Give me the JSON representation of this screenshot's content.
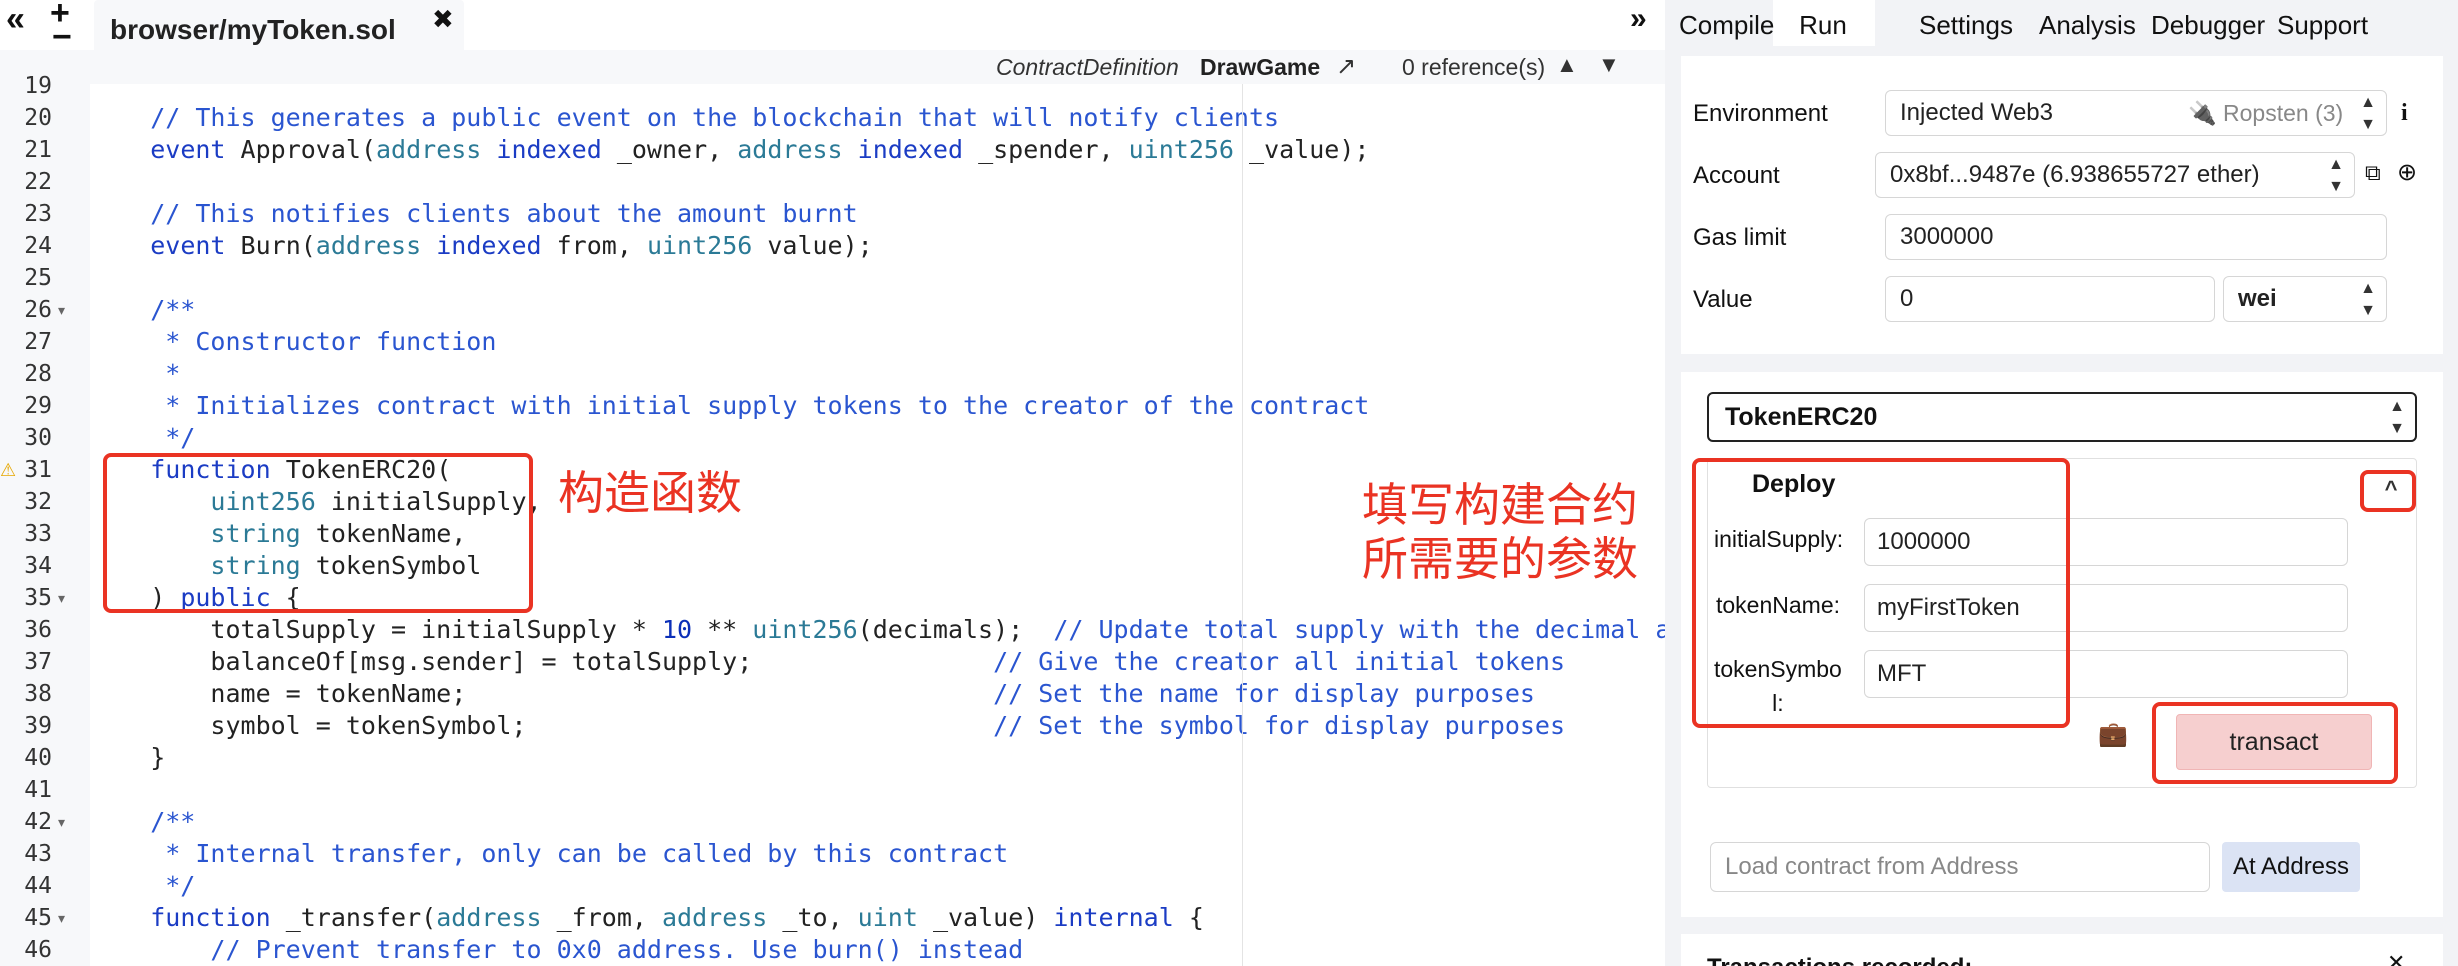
{
  "editor": {
    "tabbar": {
      "collapse_left": "«",
      "add_file": "+",
      "remove_file": "−",
      "active_tab": "browser/myToken.sol",
      "close": "✖",
      "collapse_right": "»"
    },
    "context": {
      "type": "ContractDefinition",
      "name": "DrawGame",
      "jump": "↗",
      "references": "0 reference(s)",
      "up": "▲",
      "down": "▼"
    },
    "line_numbers": [
      "19",
      "20",
      "21",
      "22",
      "23",
      "24",
      "25",
      "26",
      "27",
      "28",
      "29",
      "30",
      "31",
      "32",
      "33",
      "34",
      "35",
      "36",
      "37",
      "38",
      "39",
      "40",
      "41",
      "42",
      "43",
      "44",
      "45",
      "46"
    ],
    "code": [
      "",
      "    // This generates a public event on the blockchain that will notify clients",
      "    event Approval(address indexed _owner, address indexed _spender, uint256 _value);",
      "",
      "    // This notifies clients about the amount burnt",
      "    event Burn(address indexed from, uint256 value);",
      "",
      "    /**",
      "     * Constructor function",
      "     *",
      "     * Initializes contract with initial supply tokens to the creator of the contract",
      "     */",
      "    function TokenERC20(",
      "        uint256 initialSupply,",
      "        string tokenName,",
      "        string tokenSymbol",
      "    ) public {",
      "        totalSupply = initialSupply * 10 ** uint256(decimals);  // Update total supply with the decimal amount",
      "        balanceOf[msg.sender] = totalSupply;                // Give the creator all initial tokens",
      "        name = tokenName;                                   // Set the name for display purposes",
      "        symbol = tokenSymbol;                               // Set the symbol for display purposes",
      "    }",
      "",
      "    /**",
      "     * Internal transfer, only can be called by this contract",
      "     */",
      "    function _transfer(address _from, address _to, uint _value) internal {",
      "        // Prevent transfer to 0x0 address. Use burn() instead"
    ],
    "annotations": {
      "constructor": "构造函数",
      "fill_params": "填写构建合约\n所需要的参数"
    }
  },
  "right_panel": {
    "tabs": [
      "Compile",
      "Run",
      "Settings",
      "Analysis",
      "Debugger",
      "Support"
    ],
    "active_tab": "Run",
    "environment": {
      "label": "Environment",
      "value": "Injected Web3",
      "network": "Ropsten (3)",
      "info": "i"
    },
    "account": {
      "label": "Account",
      "value": "0x8bf...9487e (6.938655727 ether)"
    },
    "gas_limit": {
      "label": "Gas limit",
      "value": "3000000"
    },
    "value": {
      "label": "Value",
      "amount": "0",
      "unit": "wei"
    },
    "contract": "TokenERC20",
    "deploy": {
      "title": "Deploy",
      "expand": "^",
      "params": [
        {
          "label": "initialSupply:",
          "value": "1000000"
        },
        {
          "label": "tokenName:",
          "value": "myFirstToken"
        },
        {
          "label": "tokenSymbo\nl:",
          "value": "MFT"
        }
      ],
      "transact": "transact"
    },
    "load_address_placeholder": "Load contract from Address",
    "at_address": "At Address",
    "transactions_recorded": "Transactions recorded:"
  }
}
